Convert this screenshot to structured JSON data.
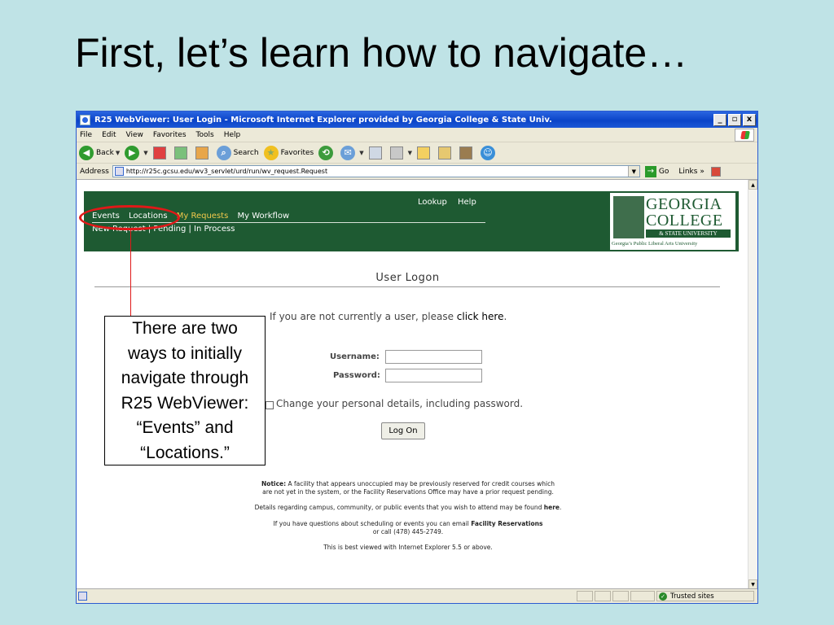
{
  "slide": {
    "title": "First, let’s learn how to navigate…"
  },
  "window": {
    "title": "R25 WebViewer: User Login - Microsoft Internet Explorer provided by Georgia College & State Univ.",
    "controls": {
      "minimize": "_",
      "maximize": "▫",
      "close": "x"
    }
  },
  "menubar": {
    "items": [
      "File",
      "Edit",
      "View",
      "Favorites",
      "Tools",
      "Help"
    ]
  },
  "toolbar": {
    "back": "Back",
    "search": "Search",
    "favorites": "Favorites"
  },
  "addressbar": {
    "label": "Address",
    "url": "http://r25c.gcsu.edu/wv3_servlet/urd/run/wv_request.Request",
    "go": "Go",
    "links": "Links"
  },
  "banner": {
    "nav_primary": [
      "Events",
      "Locations",
      "My Requests",
      "My Workflow"
    ],
    "nav_secondary": "New Request  |  Pending  |  In Process",
    "nav_tertiary": [
      "Lookup",
      "Help"
    ],
    "logo": {
      "line1": "GEORGIA",
      "line2": "COLLEGE",
      "line3": "& STATE UNIVERSITY",
      "line4": "Georgia’s Public Liberal Arts University"
    }
  },
  "logon": {
    "heading": "User Logon",
    "not_user_prefix": "If you are not currently a user, please ",
    "click_here": "click here",
    "not_user_suffix": ".",
    "username_label": "Username:",
    "password_label": "Password:",
    "change_details": "Change your personal details, including password.",
    "button": "Log On"
  },
  "notices": {
    "notice_label": "Notice:",
    "notice_line1": " A facility that appears unoccupied may be previously reserved for credit courses which",
    "notice_line2": "are not yet in the system, or the Facility Reservations Office may have a prior request pending.",
    "details_prefix": "Details regarding campus, community, or public events that you wish to attend may be found ",
    "details_link": "here",
    "details_suffix": ".",
    "questions_prefix": "If you have questions about scheduling or events you can email ",
    "questions_link": "Facility Reservations",
    "questions_line2": "or call (478) 445-2749.",
    "best_viewed": "This is best viewed with Internet Explorer 5.5 or above."
  },
  "statusbar": {
    "zone": "Trusted sites"
  },
  "callout": {
    "lines": [
      "There are two",
      "ways to initially",
      "navigate through",
      "R25 WebViewer:",
      "“Events” and",
      "“Locations.”"
    ]
  },
  "colors": {
    "banner": "#1e5a32",
    "highlight": "#e01818",
    "slide_bg": "#bfe3e6",
    "nav_gold": "#f2c94c"
  }
}
